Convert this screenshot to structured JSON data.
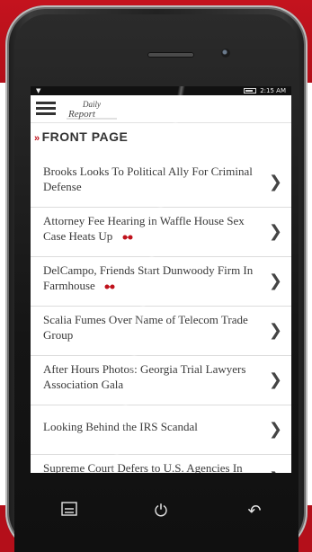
{
  "status": {
    "time": "2:15 AM"
  },
  "app": {
    "logo_text": "Daily Report"
  },
  "section": {
    "title": "FRONT PAGE"
  },
  "articles": [
    {
      "title": "Brooks Looks To Political Ally For Criminal Defense"
    },
    {
      "title": "Attorney Fee Hearing in Waffle House Sex Case Heats Up"
    },
    {
      "title": "DelCampo, Friends Start Dunwoody Firm In Farmhouse"
    },
    {
      "title": "Scalia Fumes Over Name of Telecom Trade Group"
    },
    {
      "title": "After Hours Photos: Georgia Trial Lawyers Association Gala"
    },
    {
      "title": "Looking Behind the IRS Scandal"
    },
    {
      "title": "Supreme Court Defers to U.S. Agencies In Determining Their Own Jurisdictions"
    }
  ],
  "icons": {
    "menu": "hamburger-icon",
    "chevron": "chevron-right-icon",
    "power": "power-icon",
    "back": "back-icon",
    "glasses": "glasses-icon"
  },
  "colors": {
    "brand_red": "#c0121c"
  }
}
